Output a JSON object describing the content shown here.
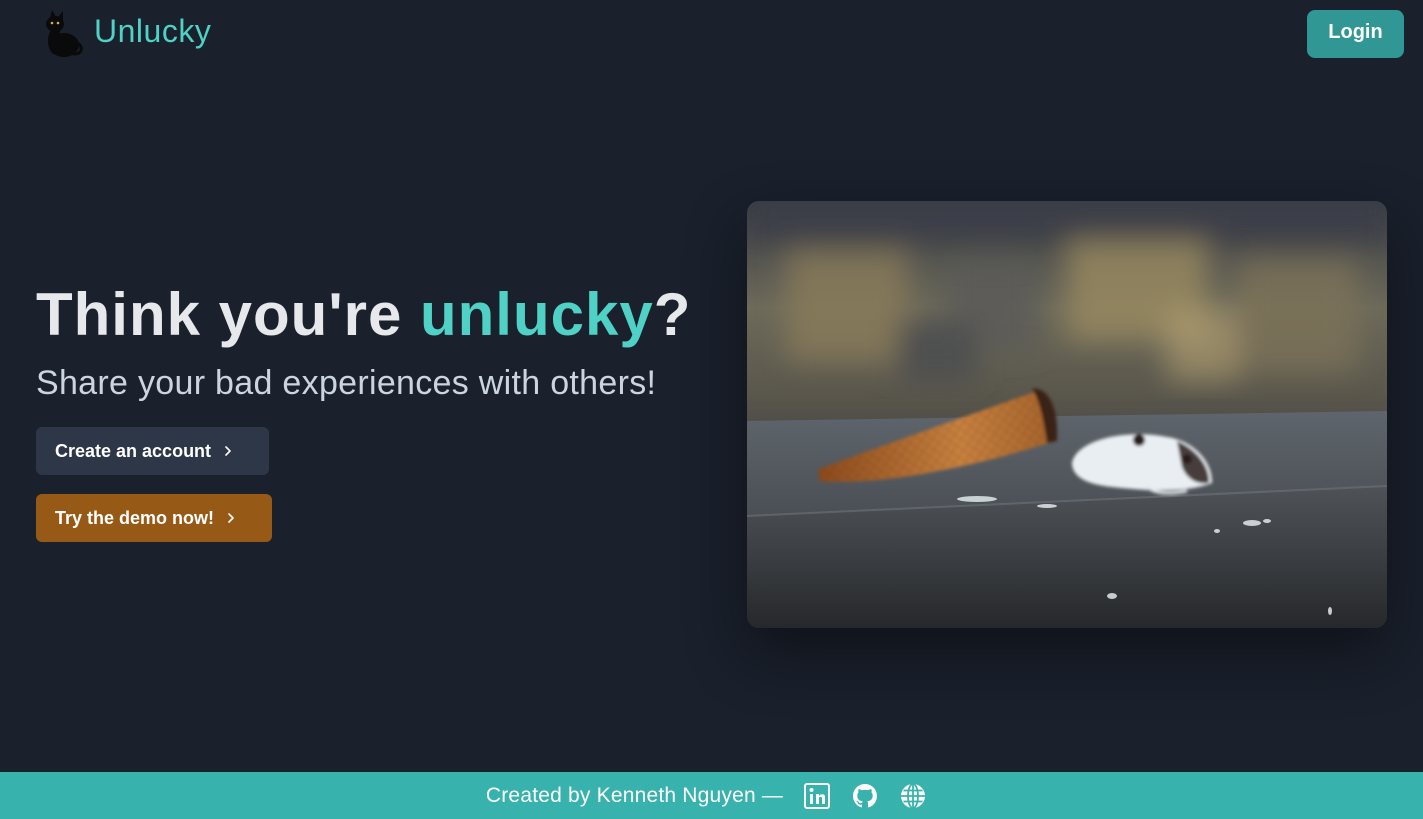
{
  "header": {
    "brand_name": "Unlucky",
    "login_label": "Login"
  },
  "hero": {
    "headline_prefix": "Think you're ",
    "headline_accent": "unlucky",
    "headline_suffix": "?",
    "subheading": "Share your bad experiences with others!",
    "create_account_label": "Create an account",
    "demo_label": "Try the demo now!"
  },
  "footer": {
    "credit": "Created by Kenneth Nguyen —",
    "links": [
      "linkedin-icon",
      "github-icon",
      "globe-icon"
    ]
  },
  "colors": {
    "background": "#1a202c",
    "accent": "#4fd1c5",
    "login_button": "#319795",
    "create_button": "#2d3748",
    "demo_button": "#975a16",
    "footer": "#38b2ac"
  },
  "icons": {
    "logo": "black-cat-icon",
    "button_chevron": "chevron-right-icon"
  }
}
